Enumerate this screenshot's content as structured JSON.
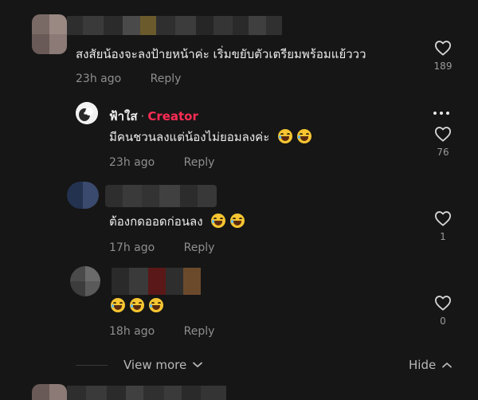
{
  "comments": [
    {
      "text": "สงสัยน้องจะลงป้ายหน้าค่ะ เริ่มขยับตัวเตรียมพร้อมแย้ววว",
      "time": "23h ago",
      "reply_label": "Reply",
      "likes": "189"
    },
    {
      "author": "ฟ้าใส",
      "separator": "·",
      "badge": "Creator",
      "text": "มีคนชวนลงแต่น้องไม่ยอมลงค่ะ",
      "time": "23h ago",
      "reply_label": "Reply",
      "likes": "76"
    },
    {
      "text": "ต้องกดออดก่อนลง",
      "time": "17h ago",
      "reply_label": "Reply",
      "likes": "1"
    },
    {
      "time": "18h ago",
      "reply_label": "Reply",
      "likes": "0"
    }
  ],
  "footer": {
    "view_more": "View more",
    "hide": "Hide"
  },
  "colors": {
    "background": "#161616",
    "creator_badge": "#fe2c55",
    "secondary_text": "#8e8e8e"
  },
  "icons": {
    "like": "heart-outline-icon",
    "more": "more-dots-icon",
    "expand": "chevron-down-icon",
    "collapse": "chevron-up-icon",
    "emoji": "tears-of-joy-emoji"
  }
}
